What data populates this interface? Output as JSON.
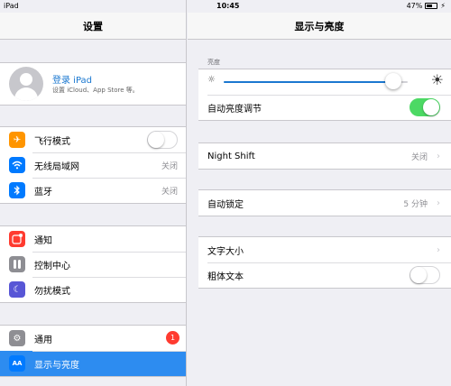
{
  "status": {
    "device": "iPad",
    "time": "10:45",
    "battery_text": "47%",
    "battery_level": 0.47
  },
  "left": {
    "title": "设置",
    "profile": {
      "title": "登录 iPad",
      "subtitle": "设置 iCloud、App Store 等。"
    },
    "groups": [
      [
        {
          "label": "飞行模式",
          "icon": "airplane-icon",
          "color": "#ff9500",
          "toggle": false
        },
        {
          "label": "无线局域网",
          "icon": "wifi-icon",
          "color": "#007aff",
          "value": "关闭"
        },
        {
          "label": "蓝牙",
          "icon": "bluetooth-icon",
          "color": "#007aff",
          "value": "关闭"
        }
      ],
      [
        {
          "label": "通知",
          "icon": "notifications-icon",
          "color": "#ff3b30"
        },
        {
          "label": "控制中心",
          "icon": "control-center-icon",
          "color": "#8e8e93"
        },
        {
          "label": "勿扰模式",
          "icon": "moon-icon",
          "color": "#5856d6"
        }
      ],
      [
        {
          "label": "通用",
          "icon": "gear-icon",
          "color": "#8e8e93",
          "badge": "1"
        },
        {
          "label": "显示与亮度",
          "icon": "display-icon",
          "color": "#007aff",
          "selected": true
        }
      ]
    ]
  },
  "right": {
    "title": "显示与亮度",
    "brightness_label": "亮度",
    "brightness_level": 0.92,
    "auto_brightness": {
      "label": "自动亮度调节",
      "on": true
    },
    "night_shift": {
      "label": "Night Shift",
      "value": "关闭"
    },
    "auto_lock": {
      "label": "自动锁定",
      "value": "5 分钟"
    },
    "text_size": {
      "label": "文字大小"
    },
    "bold_text": {
      "label": "粗体文本",
      "on": false
    }
  },
  "colors": {
    "accent": "#1b78d0",
    "toggle_on": "#4cd964",
    "badge": "#ff3b30",
    "selected_row": "#2d8cf0"
  }
}
